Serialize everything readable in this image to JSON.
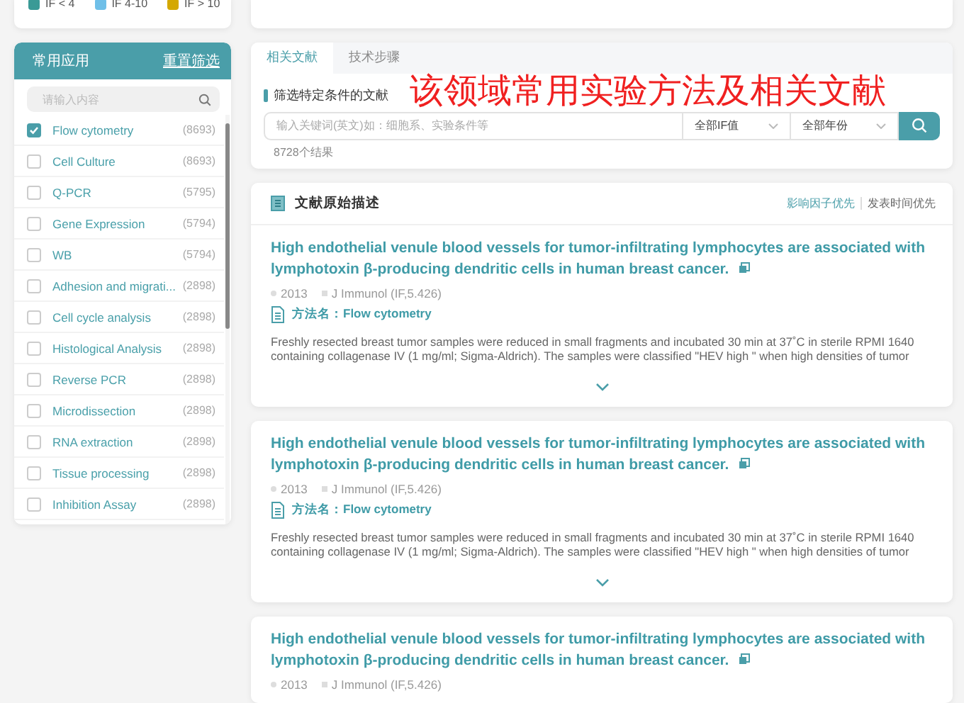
{
  "legend": [
    {
      "label": "IF < 4",
      "color": "#3a9a96"
    },
    {
      "label": "IF 4-10",
      "color": "#6fbfe8"
    },
    {
      "label": "IF > 10",
      "color": "#d4a800"
    }
  ],
  "sidebar": {
    "title": "常用应用",
    "reset": "重置筛选",
    "search_placeholder": "请输入内容",
    "items": [
      {
        "label": "Flow cytometry",
        "count": "(8693)",
        "checked": true
      },
      {
        "label": "Cell Culture",
        "count": "(8693)",
        "checked": false
      },
      {
        "label": "Q-PCR",
        "count": "(5795)",
        "checked": false
      },
      {
        "label": "Gene Expression",
        "count": "(5794)",
        "checked": false
      },
      {
        "label": "WB",
        "count": "(5794)",
        "checked": false
      },
      {
        "label": "Adhesion and migrati...",
        "count": "(2898)",
        "checked": false
      },
      {
        "label": "Cell cycle analysis",
        "count": "(2898)",
        "checked": false
      },
      {
        "label": "Histological Analysis",
        "count": "(2898)",
        "checked": false
      },
      {
        "label": "Reverse PCR",
        "count": "(2898)",
        "checked": false
      },
      {
        "label": "Microdissection",
        "count": "(2898)",
        "checked": false
      },
      {
        "label": "RNA extraction",
        "count": "(2898)",
        "checked": false
      },
      {
        "label": "Tissue processing",
        "count": "(2898)",
        "checked": false
      },
      {
        "label": "Inhibition Assay",
        "count": "(2898)",
        "checked": false
      }
    ]
  },
  "tabs": [
    {
      "label": "相关文献",
      "selected": true
    },
    {
      "label": "技术步骤",
      "selected": false
    }
  ],
  "annotation": "该领域常用实验方法及相关文献",
  "filter": {
    "title": "筛选特定条件的文献",
    "placeholder": "输入关键词(英文)如：细胞系、实验条件等",
    "if_select": "全部IF值",
    "year_select": "全部年份",
    "result_count": "8728个结果"
  },
  "literature": {
    "title": "文献原始描述",
    "sort_options": [
      {
        "label": "影响因子优先",
        "selected": true
      },
      {
        "label": "发表时间优先",
        "selected": false
      }
    ],
    "articles": [
      {
        "title": "High endothelial venule blood vessels for tumor-infiltrating lymphocytes are associated with lymphotoxin β-producing dendritic cells in human breast cancer.",
        "year": "2013",
        "journal": "J Immunol (IF,5.426)",
        "method_label": "方法名：",
        "method": "Flow cytometry",
        "description": [
          "Freshly resected breast tumor samples were reduced in small fragments and incubated 30 min at 37˚C in sterile RPMI 1640",
          "containing collagenase IV (1 mg/ml; Sigma-Aldrich). The samples were classified \"HEV high \" when high densities of tumor"
        ]
      },
      {
        "title": "High endothelial venule blood vessels for tumor-infiltrating lymphocytes are associated with lymphotoxin β-producing dendritic cells in human breast cancer.",
        "year": "2013",
        "journal": "J Immunol (IF,5.426)",
        "method_label": "方法名：",
        "method": "Flow cytometry",
        "description": [
          "Freshly resected breast tumor samples were reduced in small fragments and incubated 30 min at 37˚C in sterile RPMI 1640",
          "containing collagenase IV (1 mg/ml; Sigma-Aldrich). The samples were classified \"HEV high \" when high densities of tumor"
        ]
      },
      {
        "title": "High endothelial venule blood vessels for tumor-infiltrating lymphocytes are associated with lymphotoxin β-producing dendritic cells in human breast cancer.",
        "year": "2013",
        "journal": "J Immunol (IF,5.426)"
      }
    ]
  }
}
